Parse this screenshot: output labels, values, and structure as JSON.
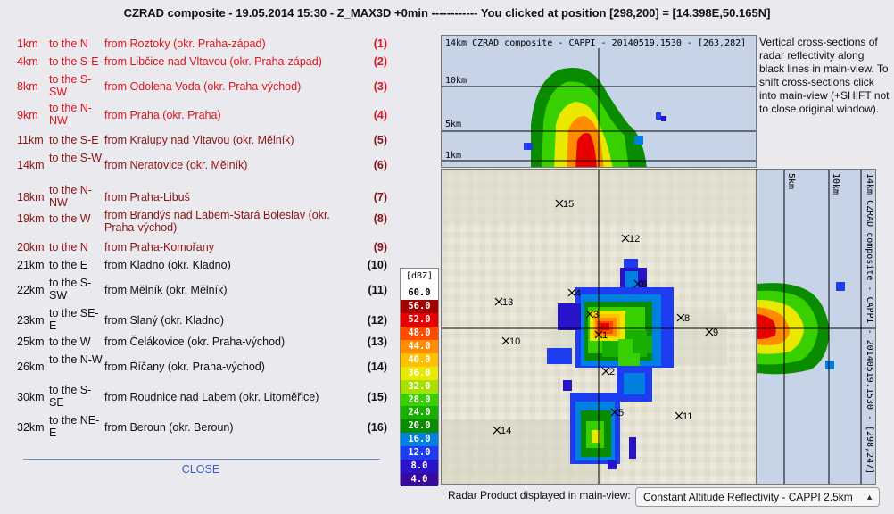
{
  "window": {
    "title": "CZRAD composite - 19.05.2014 15:30 - Z_MAX3D +0min ------------ You clicked at position [298,200] = [14.398E,50.165N]"
  },
  "locations": [
    {
      "dist": "1km",
      "dir": "to the N",
      "from": "from Roztoky (okr. Praha-západ)",
      "num": "(1)"
    },
    {
      "dist": "4km",
      "dir": "to the S-E",
      "from": "from Libčice nad Vltavou (okr. Praha-západ)",
      "num": "(2)"
    },
    {
      "dist": "8km",
      "dir": "to the S-SW",
      "from": "from Odolena Voda (okr. Praha-východ)",
      "num": "(3)"
    },
    {
      "dist": "9km",
      "dir": "to the N-NW",
      "from": "from Praha (okr. Praha)",
      "num": "(4)"
    },
    {
      "dist": "11km",
      "dir": "to the S-E",
      "from": "from Kralupy nad Vltavou (okr. Mělník)",
      "num": "(5)"
    },
    {
      "dist": "14km",
      "dir": "to the S-W",
      "from": "from Neratovice (okr. Mělník)",
      "num": "(6)"
    },
    {
      "dist": "18km",
      "dir": "to the N-NW",
      "from": "from Praha-Libuš",
      "num": "(7)"
    },
    {
      "dist": "19km",
      "dir": "to the W",
      "from": "from Brandýs nad Labem-Stará Boleslav (okr. Praha-východ)",
      "num": "(8)"
    },
    {
      "dist": "20km",
      "dir": "to the N",
      "from": "from Praha-Komořany",
      "num": "(9)"
    },
    {
      "dist": "21km",
      "dir": "to the E",
      "from": "from Kladno (okr. Kladno)",
      "num": "(10)"
    },
    {
      "dist": "22km",
      "dir": "to the S-SW",
      "from": "from Mělník (okr. Mělník)",
      "num": "(11)"
    },
    {
      "dist": "23km",
      "dir": "to the SE-E",
      "from": "from Slaný (okr. Kladno)",
      "num": "(12)"
    },
    {
      "dist": "25km",
      "dir": "to the W",
      "from": "from Čelákovice (okr. Praha-východ)",
      "num": "(13)"
    },
    {
      "dist": "26km",
      "dir": "to the N-W",
      "from": "from Říčany (okr. Praha-východ)",
      "num": "(14)"
    },
    {
      "dist": "30km",
      "dir": "to the S-SE",
      "from": "from Roudnice nad Labem (okr. Litoměřice)",
      "num": "(15)"
    },
    {
      "dist": "32km",
      "dir": "to the NE-E",
      "from": "from Beroun (okr. Beroun)",
      "num": "(16)"
    }
  ],
  "close_label": "CLOSE",
  "legend": {
    "unit": "[dBZ]",
    "levels": [
      {
        "label": "60.0",
        "color": "#ffffff",
        "text": "#000000"
      },
      {
        "label": "56.0",
        "color": "#a30000",
        "text": "#ffffff"
      },
      {
        "label": "52.0",
        "color": "#e80000",
        "text": "#ffffff"
      },
      {
        "label": "48.0",
        "color": "#ff4a00",
        "text": "#ffffff"
      },
      {
        "label": "44.0",
        "color": "#ff8c00",
        "text": "#ffffff"
      },
      {
        "label": "40.0",
        "color": "#ffc000",
        "text": "#ffffff"
      },
      {
        "label": "36.0",
        "color": "#e8e800",
        "text": "#ffffff"
      },
      {
        "label": "32.0",
        "color": "#a8e000",
        "text": "#ffffff"
      },
      {
        "label": "28.0",
        "color": "#38d000",
        "text": "#ffffff"
      },
      {
        "label": "24.0",
        "color": "#18b000",
        "text": "#ffffff"
      },
      {
        "label": "20.0",
        "color": "#0a8c00",
        "text": "#ffffff"
      },
      {
        "label": "16.0",
        "color": "#0080e0",
        "text": "#ffffff"
      },
      {
        "label": "12.0",
        "color": "#1e3cf0",
        "text": "#ffffff"
      },
      {
        "label": "8.0",
        "color": "#2814c8",
        "text": "#ffffff"
      },
      {
        "label": "4.0",
        "color": "#3a0a9c",
        "text": "#ffffff"
      }
    ]
  },
  "vsection_top": {
    "header": "14km   CZRAD composite - CAPPI - 20140519.1530 - [263,282]",
    "levels": [
      "10km",
      "5km",
      "1km"
    ]
  },
  "vsection_right": {
    "header": "14km   CZRAD composite - CAPPI - 20140519.1530 - [298,247]",
    "levels": [
      "5km",
      "10km"
    ]
  },
  "map_markers": [
    "15",
    "12",
    "6",
    "4",
    "13",
    "3",
    "8",
    "1",
    "9",
    "10",
    "2",
    "5",
    "11",
    "14"
  ],
  "note": "Vertical cross-sections of radar reflectivity along black lines in main-view. To shift cross-sections click into main-view (+SHIFT not to close original window).",
  "product_label": "Radar Product displayed in main-view:",
  "product_select": {
    "value": "Constant Altitude Reflectivity - CAPPI 2.5km"
  }
}
